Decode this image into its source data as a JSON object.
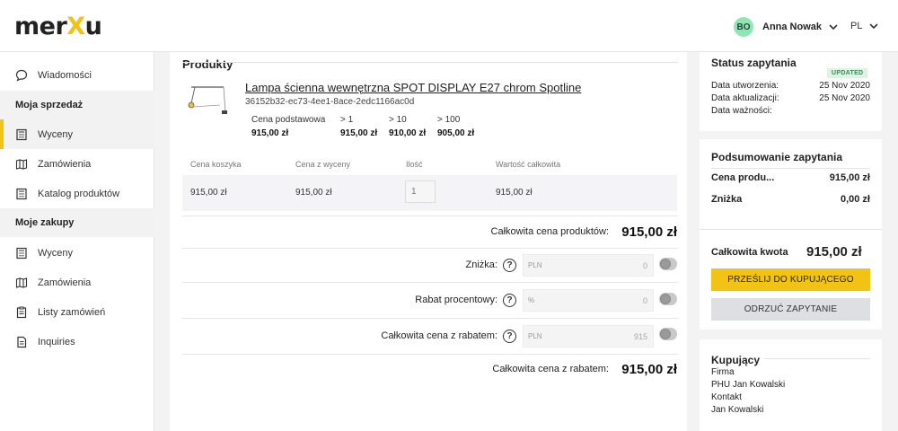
{
  "header": {
    "logo_left": "mer",
    "logo_x": "X",
    "logo_right": "u",
    "avatar_initials": "BO",
    "user_name": "Anna Nowak",
    "language": "PL"
  },
  "sidebar": {
    "items": [
      {
        "label": "Wiadomości"
      },
      {
        "label": "Wyceny"
      },
      {
        "label": "Zamówienia"
      },
      {
        "label": "Katalog produktów"
      },
      {
        "label": "Wyceny"
      },
      {
        "label": "Zamówienia"
      },
      {
        "label": "Listy zamówień"
      },
      {
        "label": "Inquiries"
      }
    ],
    "headings": [
      "Moja sprzedaż",
      "Moje zakupy"
    ]
  },
  "products": {
    "section_title": "Produkty",
    "name": "Lampa ścienna wewnętrzna SPOT DISPLAY E27 chrom Spotline",
    "id": "36152b32-ec73-4ee1-8ace-2edc1166ac0d",
    "tiers": [
      {
        "label": "Cena podstawowa",
        "value": "915,00 zł"
      },
      {
        "label": "> 1",
        "value": "915,00 zł"
      },
      {
        "label": "> 10",
        "value": "910,00 zł"
      },
      {
        "label": "> 100",
        "value": "905,00 zł"
      }
    ],
    "table": {
      "headers": [
        "Cena koszyka",
        "Cena z wyceny",
        "Ilość",
        "Wartość całkowita"
      ],
      "row": [
        "915,00 zł",
        "915,00 zł",
        "1",
        "915,00 zł"
      ]
    }
  },
  "totals": {
    "products_total_label": "Całkowita cena produktów:",
    "products_total_value": "915,00 zł",
    "discount_label": "Zniżka:",
    "discount_prefix": "PLN",
    "discount_value": "0",
    "percent_label": "Rabat procentowy:",
    "percent_prefix": "%",
    "percent_value": "0",
    "discounted_label": "Całkowita cena z rabatem:",
    "discounted_prefix": "PLN",
    "discounted_value": "915",
    "final_label": "Całkowita cena z rabatem:",
    "final_value": "915,00 zł",
    "help_glyph": "?"
  },
  "status": {
    "title": "Status zapytania",
    "badge": "UPDATED",
    "rows": [
      {
        "label": "Data utworzenia:",
        "value": "25 Nov 2020"
      },
      {
        "label": "Data aktualizacji:",
        "value": "25 Nov 2020"
      },
      {
        "label": "Data ważności:",
        "value": ""
      }
    ]
  },
  "summary": {
    "title": "Podsumowanie zapytania",
    "price_label": "Cena produ...",
    "price_value": "915,00 zł",
    "discount_label": "Zniżka",
    "discount_value": "0,00 zł",
    "total_label": "Całkowita kwota",
    "total_value": "915,00 zł",
    "send_button": "PRZEŚLIJ DO KUPUJĄCEGO",
    "reject_button": "ODRZUĆ ZAPYTANIE"
  },
  "buyer": {
    "title": "Kupujący",
    "company_label": "Firma",
    "company_value": "PHU Jan Kowalski",
    "contact_label": "Kontakt",
    "contact_value": "Jan Kowalski"
  }
}
